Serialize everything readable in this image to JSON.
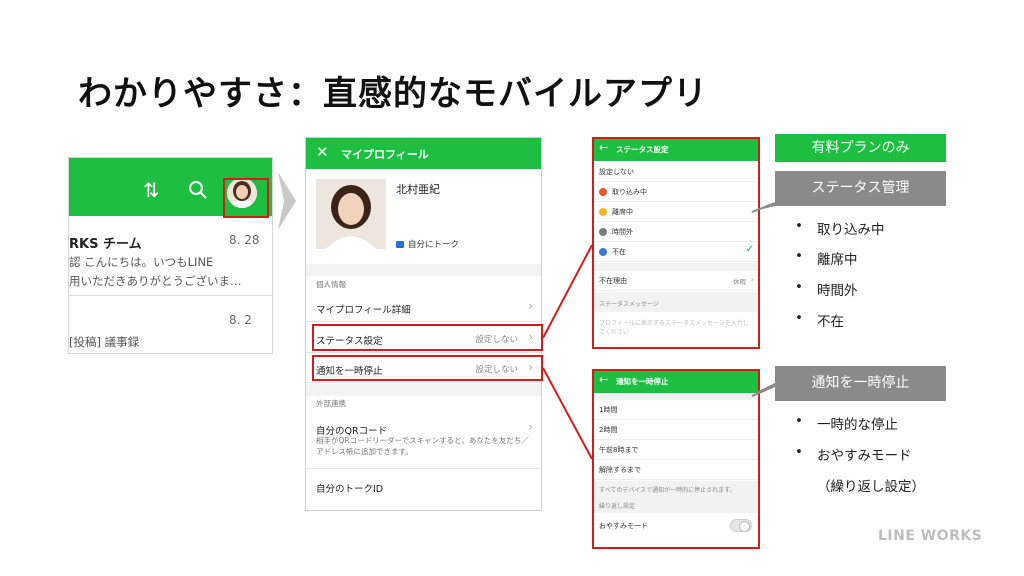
{
  "title": "わかりやすさ：直感的なモバイルアプリ",
  "left_phone": {
    "chat_title": "RKS チーム",
    "chat_date": "8. 28",
    "line1": "認 こんにちは。いつもLINE",
    "line2": "用いただきありがとうございま…",
    "date2": "8. 2",
    "line3": "[投稿] 議事録"
  },
  "profile": {
    "header": "マイプロフィール",
    "name": "北村亜紀",
    "talk": "自分にトーク",
    "section_personal": "個人情報",
    "row_detail": "マイプロフィール詳細",
    "row_status": "ステータス設定",
    "row_status_value": "設定しない",
    "row_notify": "通知を一時停止",
    "row_notify_value": "設定しない",
    "section_external": "外部連携",
    "row_qr": "自分のQRコード",
    "qr_desc": "相手がQRコードリーダーでスキャンすると、あなたを友だち／アドレス帳に追加できます。",
    "row_talk_id": "自分のトークID"
  },
  "status_screen": {
    "header": "ステータス設定",
    "none": "設定しない",
    "options": [
      "取り込み中",
      "離席中",
      "時間外",
      "不在"
    ],
    "option_colors": [
      "#e8572a",
      "#f2b51f",
      "#7b7b7b",
      "#3a78d6"
    ],
    "reason_label": "不在理由",
    "reason_value": "休暇",
    "message_label": "ステータスメッセージ",
    "message_placeholder": "プロフィールに表示するステータスメッセージを入力してください"
  },
  "pause_screen": {
    "header": "通知を一時停止",
    "options": [
      "1時間",
      "2時間",
      "午前8時まで",
      "解除するまで"
    ],
    "note": "すべてのデバイスで通知が一時的に停止されます。",
    "repeat_label": "繰り返し設定",
    "sleep_mode": "おやすみモード"
  },
  "labels": {
    "plan": "有料プランのみ",
    "status_mgmt": "ステータス管理",
    "status_bullets": [
      "取り込み中",
      "離席中",
      "時間外",
      "不在"
    ],
    "pause": "通知を一時停止",
    "pause_bullets": [
      "一時的な停止",
      "おやすみモード"
    ],
    "pause_sub": "（繰り返し設定）"
  },
  "logo": "LINE WORKS",
  "colors": {
    "accent_green": "#1dbf40",
    "highlight_red": "#d21d1d",
    "tag_gray": "#8a8a8a"
  }
}
